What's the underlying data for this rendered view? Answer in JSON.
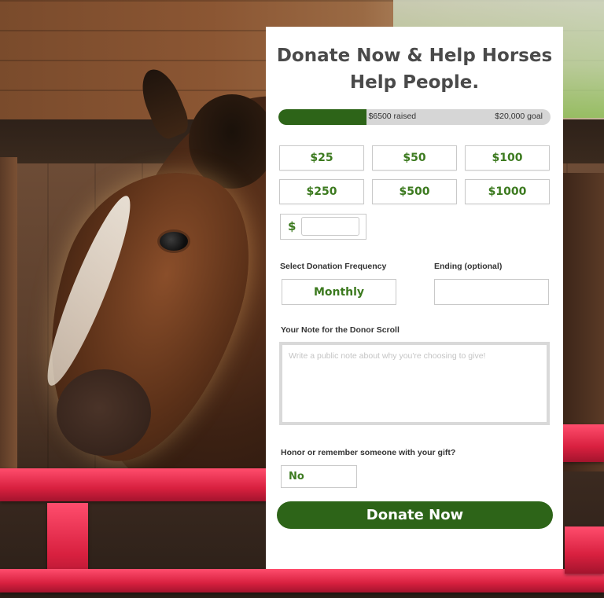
{
  "form": {
    "title": "Donate Now & Help Horses Help People.",
    "progress": {
      "raised_label": "$6500 raised",
      "goal_label": "$20,000 goal",
      "raised_value": 6500,
      "goal_value": 20000
    },
    "amounts": [
      "$25",
      "$50",
      "$100",
      "$250",
      "$500",
      "$1000"
    ],
    "custom_amount": {
      "currency_symbol": "$",
      "value": "",
      "placeholder": ""
    },
    "frequency": {
      "label": "Select Donation Frequency",
      "selected": "Monthly"
    },
    "ending": {
      "label": "Ending (optional)",
      "value": "",
      "placeholder": ""
    },
    "note": {
      "label": "Your Note for the Donor Scroll",
      "placeholder": "Write a public note about why you're choosing to give!"
    },
    "honor": {
      "label": "Honor or remember someone with your gift?",
      "selected": "No"
    },
    "submit_label": "Donate Now"
  },
  "colors": {
    "accent": "#2d6418",
    "amount_text": "#3c7a1f",
    "title_text": "#4a4a4a",
    "progress_track": "#d6d6d6",
    "rail": "#e8294a"
  },
  "background": {
    "description_icon": "horse-in-stable-photo"
  }
}
